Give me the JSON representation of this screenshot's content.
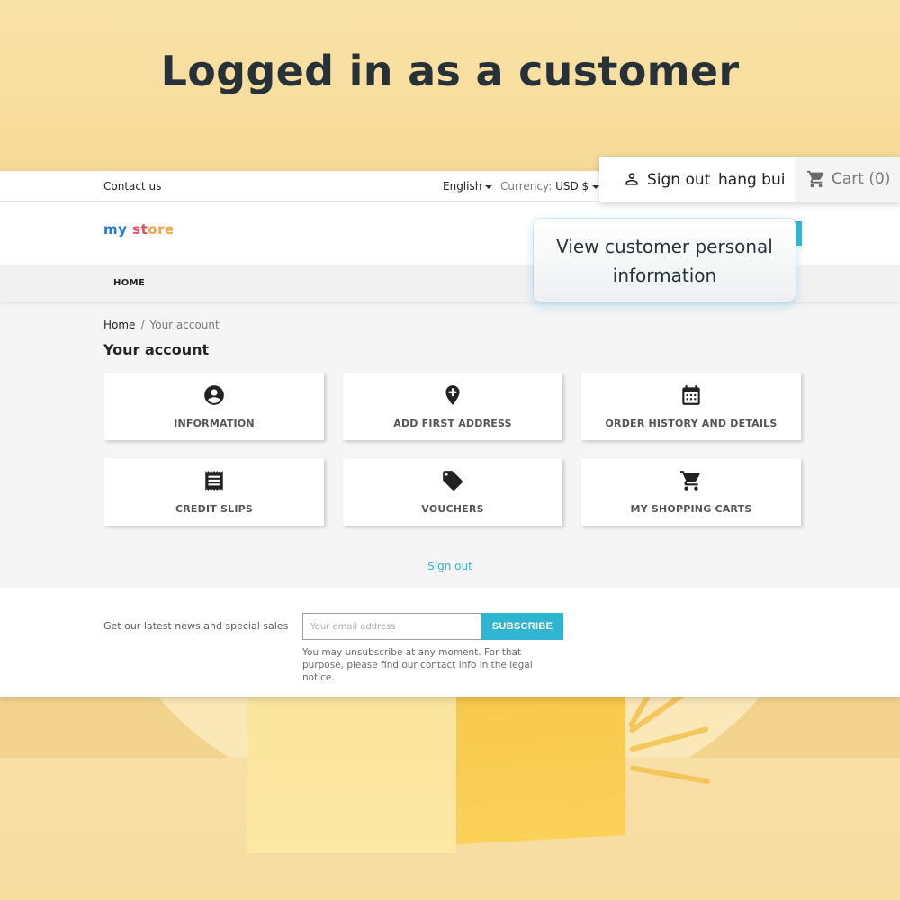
{
  "headline": "Logged in as a customer",
  "topbar": {
    "contact": "Contact us",
    "language": "English",
    "currency_label": "Currency:",
    "currency_value": "USD $"
  },
  "logo": {
    "part1": "my",
    "part2": "st",
    "part3": "ore"
  },
  "nav": {
    "home": "HOME"
  },
  "breadcrumb": {
    "home": "Home",
    "separator": "/",
    "current": "Your account"
  },
  "page_title": "Your account",
  "tiles": [
    {
      "label": "INFORMATION",
      "icon": "account-circle-icon"
    },
    {
      "label": "ADD FIRST ADDRESS",
      "icon": "add-location-icon"
    },
    {
      "label": "ORDER HISTORY AND DETAILS",
      "icon": "calendar-icon"
    },
    {
      "label": "CREDIT SLIPS",
      "icon": "receipt-icon"
    },
    {
      "label": "VOUCHERS",
      "icon": "tag-icon"
    },
    {
      "label": "MY SHOPPING CARTS",
      "icon": "cart-icon"
    }
  ],
  "signout_link": "Sign out",
  "footer": {
    "newsletter_text": "Get our latest news and special sales",
    "email_placeholder": "Your email address",
    "subscribe": "SUBSCRIBE",
    "legal": "You may unsubscribe at any moment. For that purpose, please find our contact info in the legal notice."
  },
  "account_bar": {
    "signout": "Sign out",
    "username": "hang bui",
    "cart": "Cart (0)"
  },
  "tooltip": {
    "line1": "View customer personal",
    "line2": "information"
  },
  "colors": {
    "accent": "#2fb5d2",
    "background": "#f6dd9e",
    "headline": "#263238"
  }
}
